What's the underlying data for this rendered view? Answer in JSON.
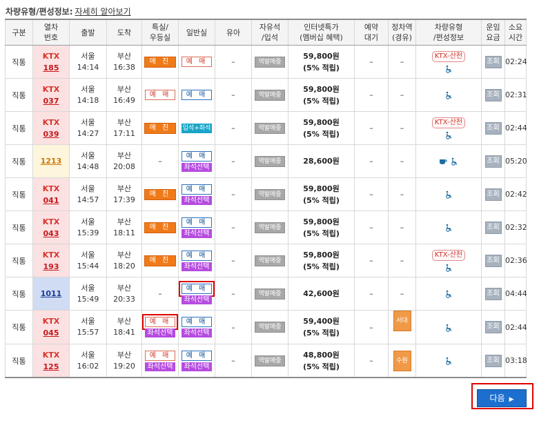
{
  "info": {
    "label": "차량유형/편성정보:",
    "link": "자세히 알아보기"
  },
  "headers": {
    "type": [
      "구분"
    ],
    "train": [
      "열차",
      "번호"
    ],
    "dep": [
      "출발"
    ],
    "arr": [
      "도착"
    ],
    "first": [
      "특실/",
      "우등실"
    ],
    "std": [
      "일반실"
    ],
    "child": [
      "유아"
    ],
    "free": [
      "자유석",
      "/입석"
    ],
    "price": [
      "인터넷특가",
      "(멤버십 혜택)"
    ],
    "wait": [
      "예약",
      "대기"
    ],
    "via": [
      "정차역",
      "(경유)"
    ],
    "car": [
      "차량유형",
      "/편성정보"
    ],
    "fare": [
      "운임",
      "요금"
    ],
    "dur": [
      "소요",
      "시간"
    ]
  },
  "labels": {
    "direct": "직통",
    "sold": "매 진",
    "reserve": "예 매",
    "seat": "좌석선택",
    "stand": "입석+좌석",
    "gray": "역발매중",
    "dash": "–",
    "inquiry": "조회",
    "ktx_sancheon": "KTX-산천",
    "next": "다음"
  },
  "rows": [
    {
      "type": "직통",
      "train_type": "KTX",
      "train_no": "185",
      "dep_station": "서울",
      "dep_time": "14:14",
      "arr_station": "부산",
      "arr_time": "16:38",
      "price": "59,800원",
      "reward": "(5% 적립)",
      "duration": "02:24"
    },
    {
      "type": "직통",
      "train_type": "KTX",
      "train_no": "037",
      "dep_station": "서울",
      "dep_time": "14:18",
      "arr_station": "부산",
      "arr_time": "16:49",
      "price": "59,800원",
      "reward": "(5% 적립)",
      "duration": "02:31"
    },
    {
      "type": "직통",
      "train_type": "KTX",
      "train_no": "039",
      "dep_station": "서울",
      "dep_time": "14:27",
      "arr_station": "부산",
      "arr_time": "17:11",
      "price": "59,800원",
      "reward": "(5% 적립)",
      "duration": "02:44"
    },
    {
      "type": "직통",
      "train_type": "",
      "train_no": "1213",
      "dep_station": "서울",
      "dep_time": "14:48",
      "arr_station": "부산",
      "arr_time": "20:08",
      "price": "28,600원",
      "reward": "",
      "duration": "05:20"
    },
    {
      "type": "직통",
      "train_type": "KTX",
      "train_no": "041",
      "dep_station": "서울",
      "dep_time": "14:57",
      "arr_station": "부산",
      "arr_time": "17:39",
      "price": "59,800원",
      "reward": "(5% 적립)",
      "duration": "02:42"
    },
    {
      "type": "직통",
      "train_type": "KTX",
      "train_no": "043",
      "dep_station": "서울",
      "dep_time": "15:39",
      "arr_station": "부산",
      "arr_time": "18:11",
      "price": "59,800원",
      "reward": "(5% 적립)",
      "duration": "02:32"
    },
    {
      "type": "직통",
      "train_type": "KTX",
      "train_no": "193",
      "dep_station": "서울",
      "dep_time": "15:44",
      "arr_station": "부산",
      "arr_time": "18:20",
      "price": "59,800원",
      "reward": "(5% 적립)",
      "duration": "02:36"
    },
    {
      "type": "직통",
      "train_type": "",
      "train_no": "1011",
      "dep_station": "서울",
      "dep_time": "15:49",
      "arr_station": "부산",
      "arr_time": "20:33",
      "price": "42,600원",
      "reward": "",
      "duration": "04:44"
    },
    {
      "type": "직통",
      "train_type": "KTX",
      "train_no": "045",
      "dep_station": "서울",
      "dep_time": "15:57",
      "arr_station": "부산",
      "arr_time": "18:41",
      "price": "59,400원",
      "reward": "(5% 적립)",
      "via": "서대구",
      "duration": "02:44"
    },
    {
      "type": "직통",
      "train_type": "KTX",
      "train_no": "125",
      "dep_station": "서울",
      "dep_time": "16:02",
      "arr_station": "부산",
      "arr_time": "19:20",
      "price": "48,800원",
      "reward": "(5% 적립)",
      "via": "수원",
      "duration": "03:18"
    }
  ]
}
